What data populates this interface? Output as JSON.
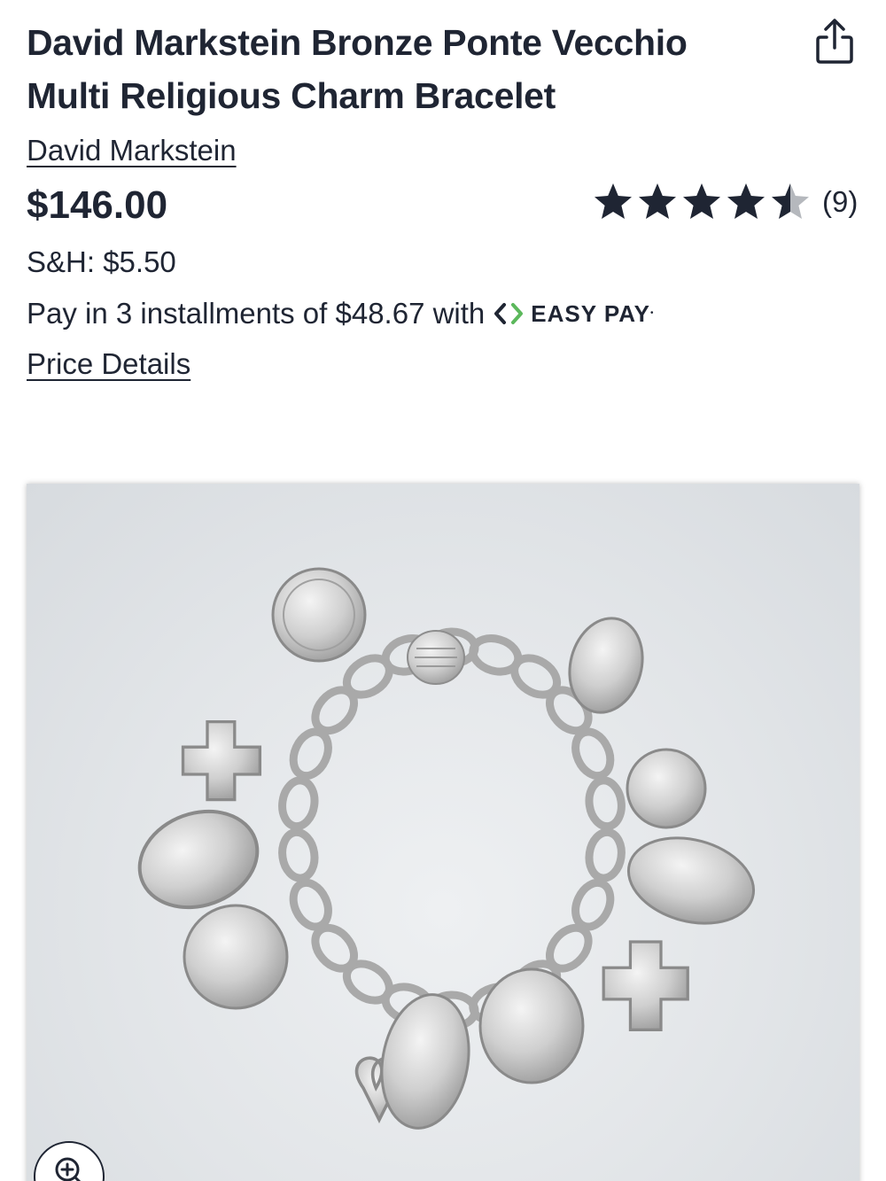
{
  "product": {
    "title": "David Markstein Bronze Ponte Vecchio Multi Religious Charm Bracelet",
    "brand": "David Markstein",
    "price": "$146.00",
    "shipping": "S&H: $5.50",
    "installments_text": "Pay in 3 installments of $48.67 with",
    "easypay_label": "EASY PAY",
    "price_details_label": "Price Details"
  },
  "rating": {
    "value": 4.5,
    "max": 5,
    "review_count": "(9)"
  },
  "icons": {
    "share": "share-icon",
    "star": "star-icon",
    "easypay": "easypay-logo-icon",
    "zoom": "zoom-in-icon"
  },
  "colors": {
    "text": "#1f2533",
    "star_filled": "#1f2533",
    "star_empty": "#b5b8bd",
    "easypay_green": "#5cb85c"
  }
}
